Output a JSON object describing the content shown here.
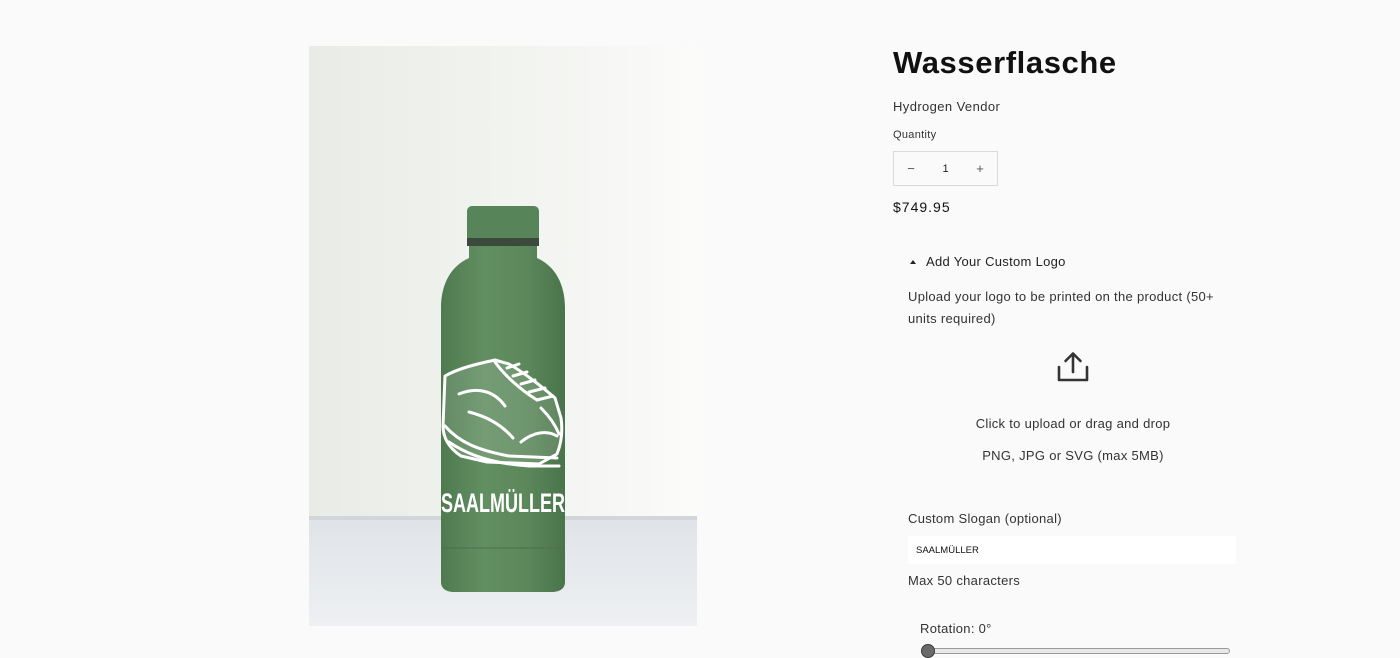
{
  "product": {
    "title": "Wasserflasche",
    "vendor": "Hydrogen Vendor",
    "price": "$749.95",
    "image": {
      "printed_brand": "SAALMÜLLER",
      "bottle_color": "#5e8a5e"
    }
  },
  "quantity": {
    "label": "Quantity",
    "value": "1",
    "decrement_symbol": "−",
    "increment_symbol": "+"
  },
  "custom_logo": {
    "toggle_label": "Add Your Custom Logo",
    "description": "Upload your logo to be printed on the product (50+ units required)",
    "upload_icon": "upload-icon",
    "upload_text": "Click to upload or drag and drop",
    "upload_hint": "PNG, JPG or SVG (max 5MB)"
  },
  "slogan": {
    "label": "Custom Slogan (optional)",
    "value": "SAALMÜLLER",
    "max_text": "Max 50 characters"
  },
  "rotation": {
    "label": "Rotation: 0°",
    "value_degrees": 0
  }
}
